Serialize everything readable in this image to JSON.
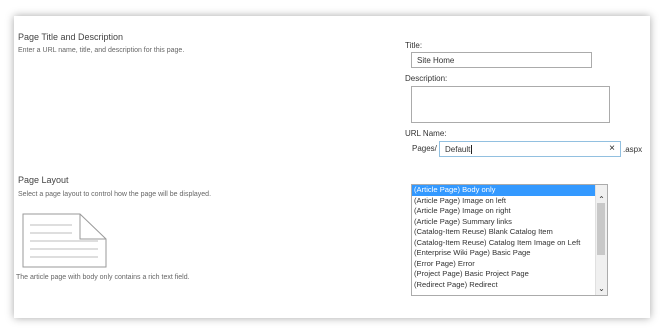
{
  "title_section": {
    "heading": "Page Title and Description",
    "description": "Enter a URL name, title, and description for this page.",
    "title_label": "Title:",
    "title_value": "Site Home",
    "description_label": "Description:",
    "description_value": "",
    "url_label": "URL Name:",
    "url_prefix": "Pages/",
    "url_value": "Default",
    "url_suffix": ".aspx",
    "clear_glyph": "×"
  },
  "layout_section": {
    "heading": "Page Layout",
    "description": "Select a page layout to control how the page will be displayed.",
    "preview_caption": "The article page with body only contains a rich text field.",
    "options": [
      "(Article Page) Body only",
      "(Article Page) Image on left",
      "(Article Page) Image on right",
      "(Article Page) Summary links",
      "(Catalog-Item Reuse) Blank Catalog Item",
      "(Catalog-Item Reuse) Catalog Item Image on Left",
      "(Enterprise Wiki Page) Basic Page",
      "(Error Page) Error",
      "(Project Page) Basic Project Page",
      "(Redirect Page) Redirect"
    ],
    "selected_index": 0
  },
  "colors": {
    "selection": "#3399ff",
    "focus_border": "#92c0e0"
  }
}
